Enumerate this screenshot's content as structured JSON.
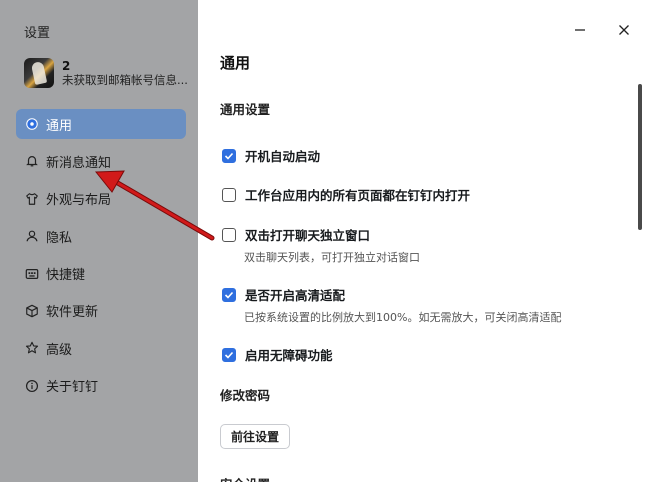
{
  "sidebar": {
    "title": "设置",
    "profile": {
      "name": "2",
      "status": "未获取到邮箱帐号信息..."
    },
    "items": [
      {
        "label": "通用",
        "icon": "gear-icon",
        "active": true
      },
      {
        "label": "新消息通知",
        "icon": "bell-icon",
        "active": false
      },
      {
        "label": "外观与布局",
        "icon": "shirt-icon",
        "active": false
      },
      {
        "label": "隐私",
        "icon": "user-icon",
        "active": false
      },
      {
        "label": "快捷键",
        "icon": "keyboard-icon",
        "active": false
      },
      {
        "label": "软件更新",
        "icon": "cube-icon",
        "active": false
      },
      {
        "label": "高级",
        "icon": "star-icon",
        "active": false
      },
      {
        "label": "关于钉钉",
        "icon": "info-icon",
        "active": false
      }
    ]
  },
  "window": {
    "minimize_icon": "minimize-icon",
    "close_icon": "close-icon"
  },
  "main": {
    "title": "通用",
    "general_section": "通用设置",
    "options": [
      {
        "label": "开机自动启动",
        "checked": true,
        "desc": ""
      },
      {
        "label": "工作台应用内的所有页面都在钉钉内打开",
        "checked": false,
        "desc": ""
      },
      {
        "label": "双击打开聊天独立窗口",
        "checked": false,
        "desc": "双击聊天列表，可打开独立对话窗口"
      },
      {
        "label": "是否开启高清适配",
        "checked": true,
        "desc": "已按系统设置的比例放大到100%。如无需放大，可关闭高清适配"
      },
      {
        "label": "启用无障碍功能",
        "checked": true,
        "desc": ""
      }
    ],
    "password_section": "修改密码",
    "goto_button": "前往设置",
    "next_section_partial": "安全设置"
  },
  "colors": {
    "accent": "#2f6fdf",
    "sidebar_bg": "#a3a4a6",
    "active_item": "#6a8fc2",
    "annotation_arrow": "#d11a1a"
  }
}
